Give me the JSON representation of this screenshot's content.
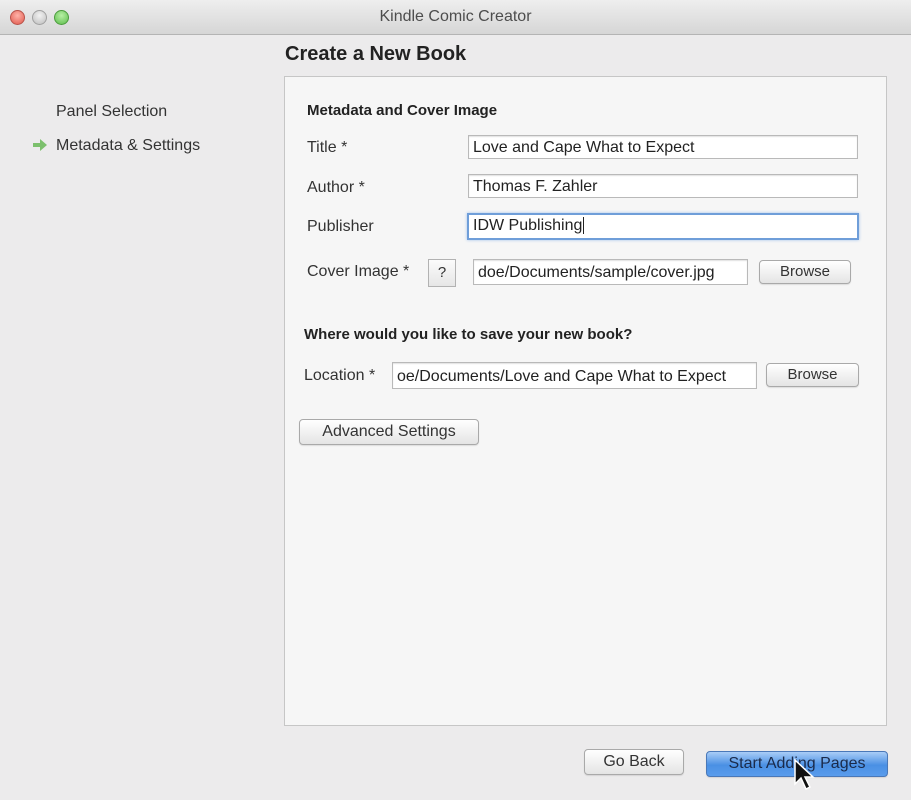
{
  "window": {
    "title": "Kindle Comic Creator"
  },
  "sidebar": {
    "items": [
      {
        "label": "Panel Selection",
        "active": false
      },
      {
        "label": "Metadata & Settings",
        "active": true
      }
    ],
    "active_indicator_icon": "arrow-right-icon"
  },
  "page": {
    "title": "Create a New Book"
  },
  "metadata_section": {
    "heading": "Metadata and Cover Image",
    "title_label": "Title *",
    "title_value": "Love and Cape What to Expect",
    "author_label": "Author *",
    "author_value": "Thomas F. Zahler",
    "publisher_label": "Publisher",
    "publisher_value": "IDW Publishing",
    "cover_label": "Cover Image *",
    "cover_help": "?",
    "cover_value": "doe/Documents/sample/cover.jpg",
    "cover_browse": "Browse"
  },
  "save_section": {
    "heading": "Where would you like to save your new book?",
    "location_label": "Location *",
    "location_value": "oe/Documents/Love and Cape What to Expect",
    "location_browse": "Browse"
  },
  "advanced_settings_label": "Advanced Settings",
  "footer": {
    "go_back": "Go Back",
    "start": "Start Adding Pages"
  },
  "colors": {
    "accent": "#4a90e4",
    "focus_ring": "#6f9ed9",
    "active_arrow": "#7cc06d"
  }
}
